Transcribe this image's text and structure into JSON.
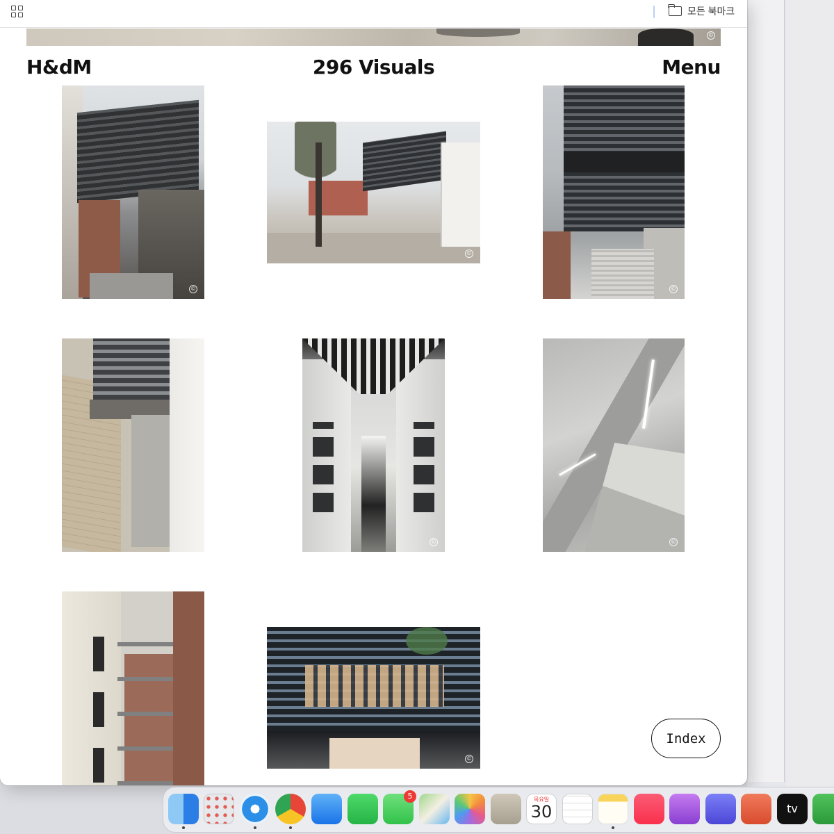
{
  "bookmarks_bar": {
    "all_bookmarks_label": "모든 북마크"
  },
  "site": {
    "logo": "H&dM",
    "title": "296 Visuals",
    "menu_label": "Menu",
    "index_label": "Index",
    "copyright_symbol": "©"
  },
  "dock": {
    "messages_badge": "5",
    "calendar_day": "목요일",
    "calendar_date": "30",
    "tv_label": "tv"
  }
}
